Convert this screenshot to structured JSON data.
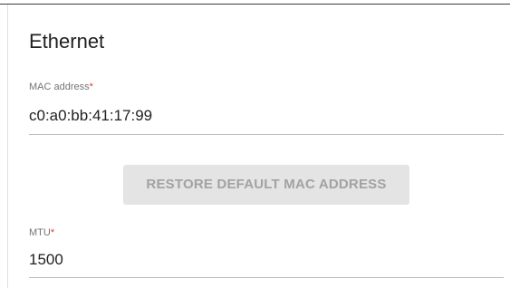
{
  "section": {
    "title": "Ethernet"
  },
  "mac": {
    "label": "MAC address",
    "required_mark": "*",
    "value": "c0:a0:bb:41:17:99"
  },
  "restore_button": {
    "label": "RESTORE DEFAULT MAC ADDRESS",
    "state": "disabled"
  },
  "mtu": {
    "label": "MTU",
    "required_mark": "*",
    "value": "1500"
  },
  "colors": {
    "required_asterisk": "#e53935",
    "button_bg": "#e4e4e4",
    "button_text": "#a2a2a2",
    "label_text": "#757575",
    "value_text": "#212121"
  }
}
